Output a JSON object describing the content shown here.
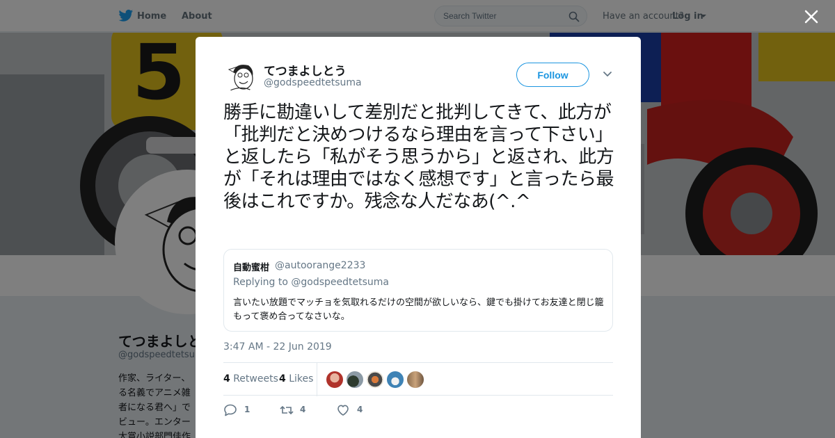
{
  "nav": {
    "home": "Home",
    "about": "About",
    "search_placeholder": "Search Twitter",
    "have_account": "Have an account?",
    "login": "Log in"
  },
  "profile": {
    "name": "てつまよしとう",
    "handle": "@godspeedtetsuma",
    "bio": "作家、ライター、る名義でアニメ雑者になる君へ」でビュー。エンター大賞小説部門佳作"
  },
  "tweet": {
    "author_name": "てつまよしとう",
    "author_handle": "@godspeedtetsuma",
    "follow_label": "Follow",
    "text": "勝手に勘違いして差別だと批判してきて、此方が「批判だと決めつけるなら理由を言って下さい」と返したら「私がそう思うから」と返され、此方が「それは理由ではなく感想です」と言ったら最後はこれですか。残念な人だなあ(^.^",
    "timestamp": "3:47 AM - 22 Jun 2019",
    "retweets_count": "4",
    "retweets_label": "Retweets",
    "likes_count": "4",
    "likes_label": "Likes",
    "actions": {
      "reply_count": "1",
      "retweet_count": "4",
      "like_count": "4"
    }
  },
  "quote": {
    "name": "自動蜜柑",
    "handle": "@autoorange2233",
    "replying_to": "Replying to @godspeedtetsuma",
    "text": "言いたい放題でマッチョを気取れるだけの空間が欲しいなら、鍵でも掛けてお友達と閉じ籠もって褒め合ってなさいな。"
  },
  "colors": {
    "accent": "#1b95e0",
    "twitter_blue": "#1da1f2",
    "muted": "#657786"
  },
  "icons": [
    "twitter-bird-icon",
    "search-icon",
    "close-icon",
    "chevron-down-icon",
    "reply-icon",
    "retweet-icon",
    "heart-icon"
  ]
}
